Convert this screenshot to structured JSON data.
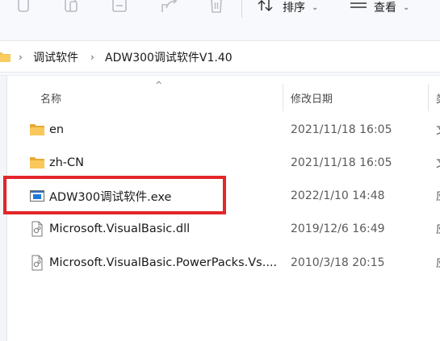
{
  "toolbar": {
    "sort_label": "排序",
    "view_label": "查看",
    "icons": [
      "copy-icon",
      "paste-icon",
      "rename-icon",
      "share-icon",
      "delete-icon",
      "sort-icon",
      "view-icon"
    ]
  },
  "address": {
    "breadcrumbs": [
      "调试软件",
      "ADW300调试软件V1.40"
    ]
  },
  "columns": {
    "name": "名称",
    "date": "修改日期",
    "type_partial": "类"
  },
  "files": [
    {
      "name": "en",
      "date": "2021/11/18 16:05",
      "type_partial": "文",
      "icon": "folder-icon"
    },
    {
      "name": "zh-CN",
      "date": "2021/11/18 16:05",
      "type_partial": "文",
      "icon": "folder-icon"
    },
    {
      "name": "ADW300调试软件.exe",
      "date": "2022/1/10 14:48",
      "type_partial": "应",
      "icon": "application-icon"
    },
    {
      "name": "Microsoft.VisualBasic.dll",
      "date": "2019/12/6 16:49",
      "type_partial": "应",
      "icon": "dll-file-icon"
    },
    {
      "name": "Microsoft.VisualBasic.PowerPacks.Vs....",
      "date": "2010/3/18 20:15",
      "type_partial": "应",
      "icon": "dll-file-icon"
    }
  ],
  "colors": {
    "highlight_border": "#e3262a",
    "folder": "#f4bf4f",
    "toolbar_bg": "#f7f9fc"
  }
}
